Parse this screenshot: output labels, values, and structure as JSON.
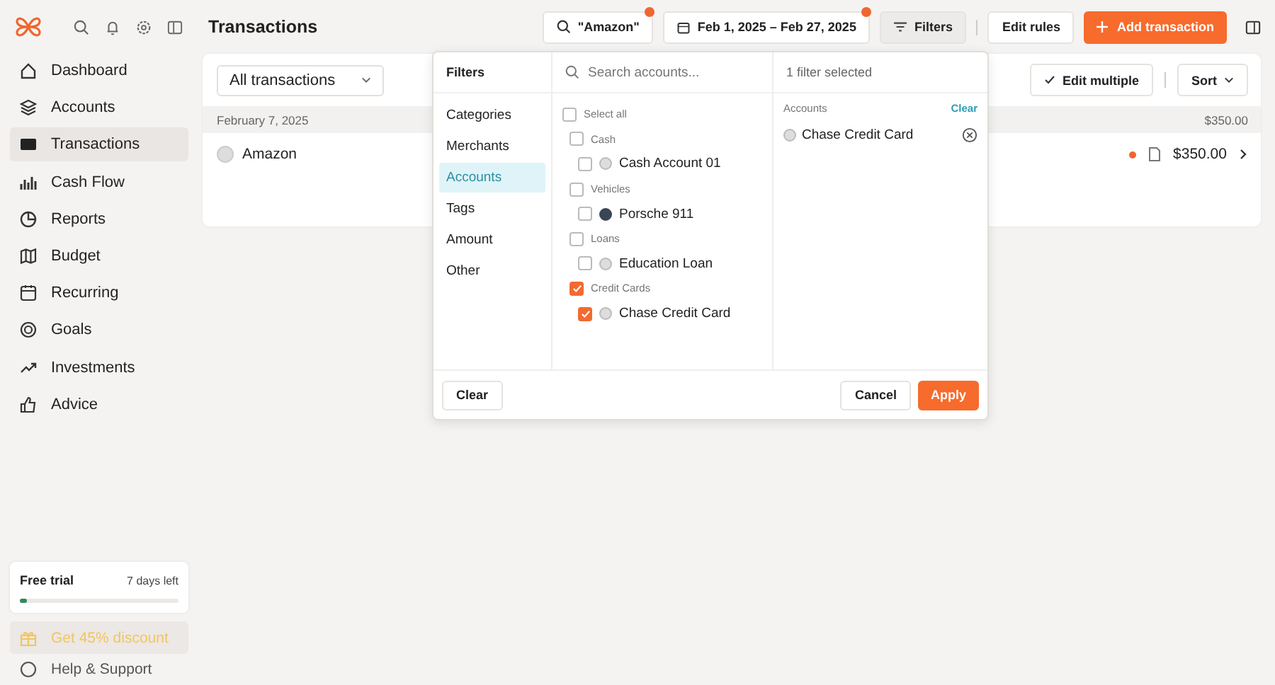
{
  "sidebar": {
    "nav": [
      {
        "label": "Dashboard",
        "selected": false
      },
      {
        "label": "Accounts",
        "selected": false
      },
      {
        "label": "Transactions",
        "selected": true
      },
      {
        "label": "Cash Flow",
        "selected": false
      },
      {
        "label": "Reports",
        "selected": false
      },
      {
        "label": "Budget",
        "selected": false
      },
      {
        "label": "Recurring",
        "selected": false
      },
      {
        "label": "Goals",
        "selected": false
      },
      {
        "label": "Investments",
        "selected": false
      },
      {
        "label": "Advice",
        "selected": false
      }
    ],
    "trial": {
      "title": "Free trial",
      "days_left": "7 days left",
      "level": 0.03
    },
    "discount": "Get 45% discount",
    "help": "Help & Support"
  },
  "header": {
    "title": "Transactions",
    "search_chip": {
      "label": "\"Amazon\"",
      "indicator": true
    },
    "date_chip": {
      "label": "Feb 1, 2025 – Feb 27, 2025",
      "indicator": true
    },
    "filters_button": {
      "label": "Filters",
      "selected": true
    },
    "edit_rules": "Edit rules",
    "add_transaction": "Add transaction"
  },
  "list": {
    "view_select": "All transactions",
    "edit_multiple": "Edit multiple",
    "sort": "Sort",
    "groups": [
      {
        "date": "February 7, 2025",
        "total": "$350.00",
        "rows": [
          {
            "merchant": "Amazon",
            "amount": "$350.00",
            "unreviewed": true
          }
        ]
      }
    ]
  },
  "filter_panel": {
    "title": "Filters",
    "tabs": [
      {
        "label": "Categories",
        "selected": false
      },
      {
        "label": "Merchants",
        "selected": false
      },
      {
        "label": "Accounts",
        "selected": true
      },
      {
        "label": "Tags",
        "selected": false
      },
      {
        "label": "Amount",
        "selected": false
      },
      {
        "label": "Other",
        "selected": false
      }
    ],
    "search": {
      "placeholder": "Search accounts..."
    },
    "select_all": {
      "label": "Select all",
      "checked": false
    },
    "groups": [
      {
        "label": "Cash",
        "checked": false,
        "children": [
          {
            "label": "Cash Account 01",
            "checked": false,
            "kind": "logo"
          }
        ]
      },
      {
        "label": "Vehicles",
        "checked": false,
        "children": [
          {
            "label": "Porsche 911",
            "checked": false,
            "kind": "photo"
          }
        ]
      },
      {
        "label": "Loans",
        "checked": false,
        "children": [
          {
            "label": "Education Loan",
            "checked": false,
            "kind": "logo"
          }
        ]
      },
      {
        "label": "Credit Cards",
        "checked": true,
        "children": [
          {
            "label": "Chase Credit Card",
            "checked": true,
            "kind": "logo"
          }
        ]
      }
    ],
    "summary": "1 filter selected",
    "section": "Accounts",
    "section_clear": "Clear",
    "chips": [
      "Chase Credit Card"
    ],
    "clear": "Clear",
    "cancel": "Cancel",
    "apply": "Apply"
  }
}
